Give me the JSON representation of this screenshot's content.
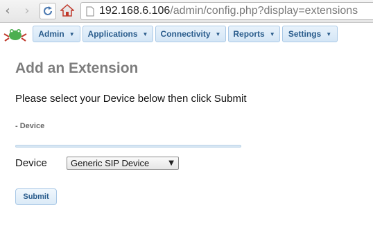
{
  "browser": {
    "back_icon": "back-arrow-icon",
    "forward_icon": "forward-arrow-icon",
    "reload_icon": "reload-icon",
    "home_icon": "home-icon",
    "url_host": "192.168.6.106",
    "url_path": "/admin/config.php?display=extensions"
  },
  "menubar": {
    "logo_icon": "frog-logo-icon",
    "items": [
      {
        "label": "Admin"
      },
      {
        "label": "Applications"
      },
      {
        "label": "Connectivity"
      },
      {
        "label": "Reports"
      },
      {
        "label": "Settings"
      }
    ],
    "accent_color": "#2a5c8c"
  },
  "main": {
    "title": "Add an Extension",
    "instructions": "Please select your Device below then click Submit",
    "section_label": "- Device",
    "device_label": "Device",
    "device_selected": "Generic SIP Device",
    "submit_label": "Submit"
  }
}
